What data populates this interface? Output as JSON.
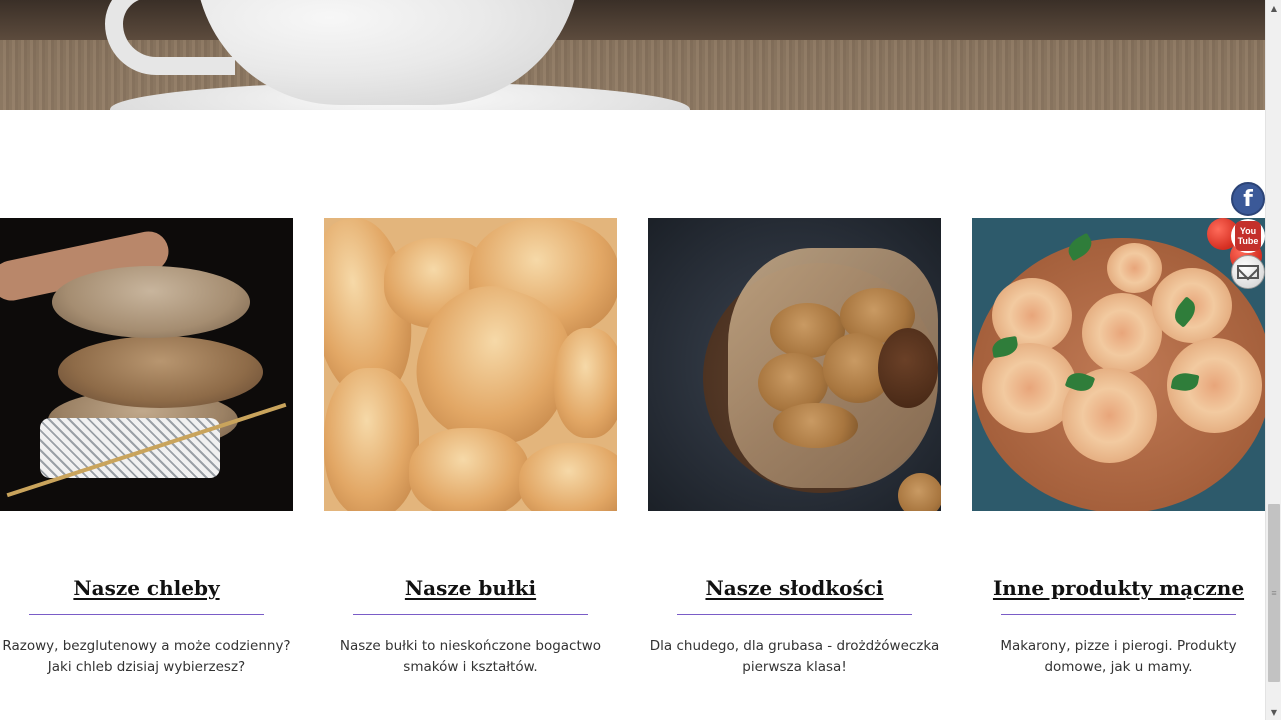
{
  "social": {
    "facebook_label": "f",
    "youtube_top": "You",
    "youtube_bottom": "Tube"
  },
  "scrollbar": {
    "up_glyph": "▲",
    "down_glyph": "▼",
    "thumb_grip": "≡"
  },
  "products": [
    {
      "title": "Nasze chleby",
      "description": "Razowy, bezglutenowy a może codzienny? Jaki chleb dzisiaj wybierzesz?"
    },
    {
      "title": "Nasze bułki",
      "description": "Nasze bułki to nieskończone bogactwo smaków i kształtów."
    },
    {
      "title": "Nasze słodkości",
      "description": "Dla chudego, dla grubasa - drożdżóweczka pierwsza klasa!"
    },
    {
      "title": "Inne produkty mączne",
      "description": "Makarony, pizze i pierogi. Produkty domowe, jak u mamy."
    }
  ],
  "colors": {
    "divider": "#7a5cc7",
    "facebook": "#3b5998",
    "youtube": "#c4302b"
  }
}
